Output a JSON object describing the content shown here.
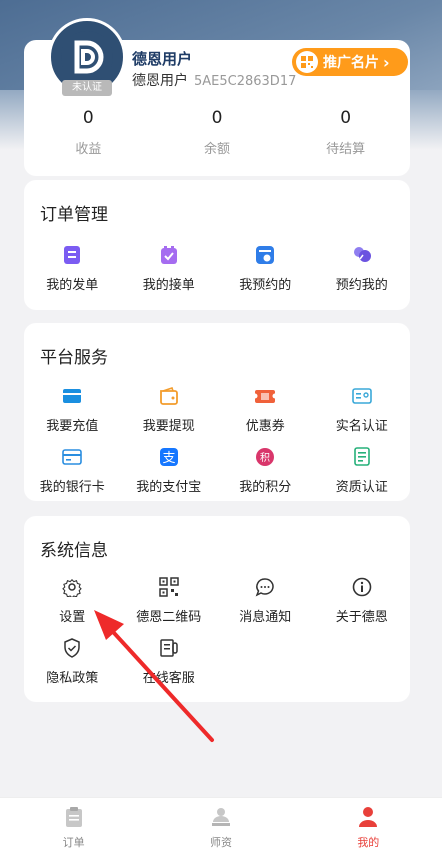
{
  "profile": {
    "nickname": "德恩用户",
    "display_name": "德恩用户",
    "user_id": "5AE5C2863D17",
    "verify_badge": "未认证",
    "promo_button": "推广名片",
    "promo_chevron": "›",
    "stats": [
      {
        "value": "0",
        "label": "收益"
      },
      {
        "value": "0",
        "label": "余额"
      },
      {
        "value": "0",
        "label": "待结算"
      }
    ]
  },
  "orders": {
    "title": "订单管理",
    "items": [
      {
        "label": "我的发单",
        "icon": "doc-icon"
      },
      {
        "label": "我的接单",
        "icon": "accept-icon"
      },
      {
        "label": "我预约的",
        "icon": "booking-icon"
      },
      {
        "label": "预约我的",
        "icon": "users-icon"
      }
    ]
  },
  "services": {
    "title": "平台服务",
    "items": [
      {
        "label": "我要充值",
        "icon": "recharge-icon"
      },
      {
        "label": "我要提现",
        "icon": "wallet-icon"
      },
      {
        "label": "优惠券",
        "icon": "coupon-icon"
      },
      {
        "label": "实名认证",
        "icon": "id-card-icon"
      },
      {
        "label": "我的银行卡",
        "icon": "bank-card-icon"
      },
      {
        "label": "我的支付宝",
        "icon": "alipay-icon"
      },
      {
        "label": "我的积分",
        "icon": "points-icon"
      },
      {
        "label": "资质认证",
        "icon": "certificate-icon"
      }
    ]
  },
  "system": {
    "title": "系统信息",
    "items": [
      {
        "label": "设置",
        "icon": "gear-icon"
      },
      {
        "label": "德恩二维码",
        "icon": "qrcode-icon"
      },
      {
        "label": "消息通知",
        "icon": "message-icon"
      },
      {
        "label": "关于德恩",
        "icon": "info-icon"
      },
      {
        "label": "隐私政策",
        "icon": "shield-icon"
      },
      {
        "label": "在线客服",
        "icon": "service-icon"
      }
    ]
  },
  "tabbar": [
    {
      "label": "订单",
      "active": false
    },
    {
      "label": "师资",
      "active": false
    },
    {
      "label": "我的",
      "active": true
    }
  ],
  "colors": {
    "accent": "#e8403a",
    "promo": "#ff9b1a",
    "brand": "#2f4f73"
  }
}
